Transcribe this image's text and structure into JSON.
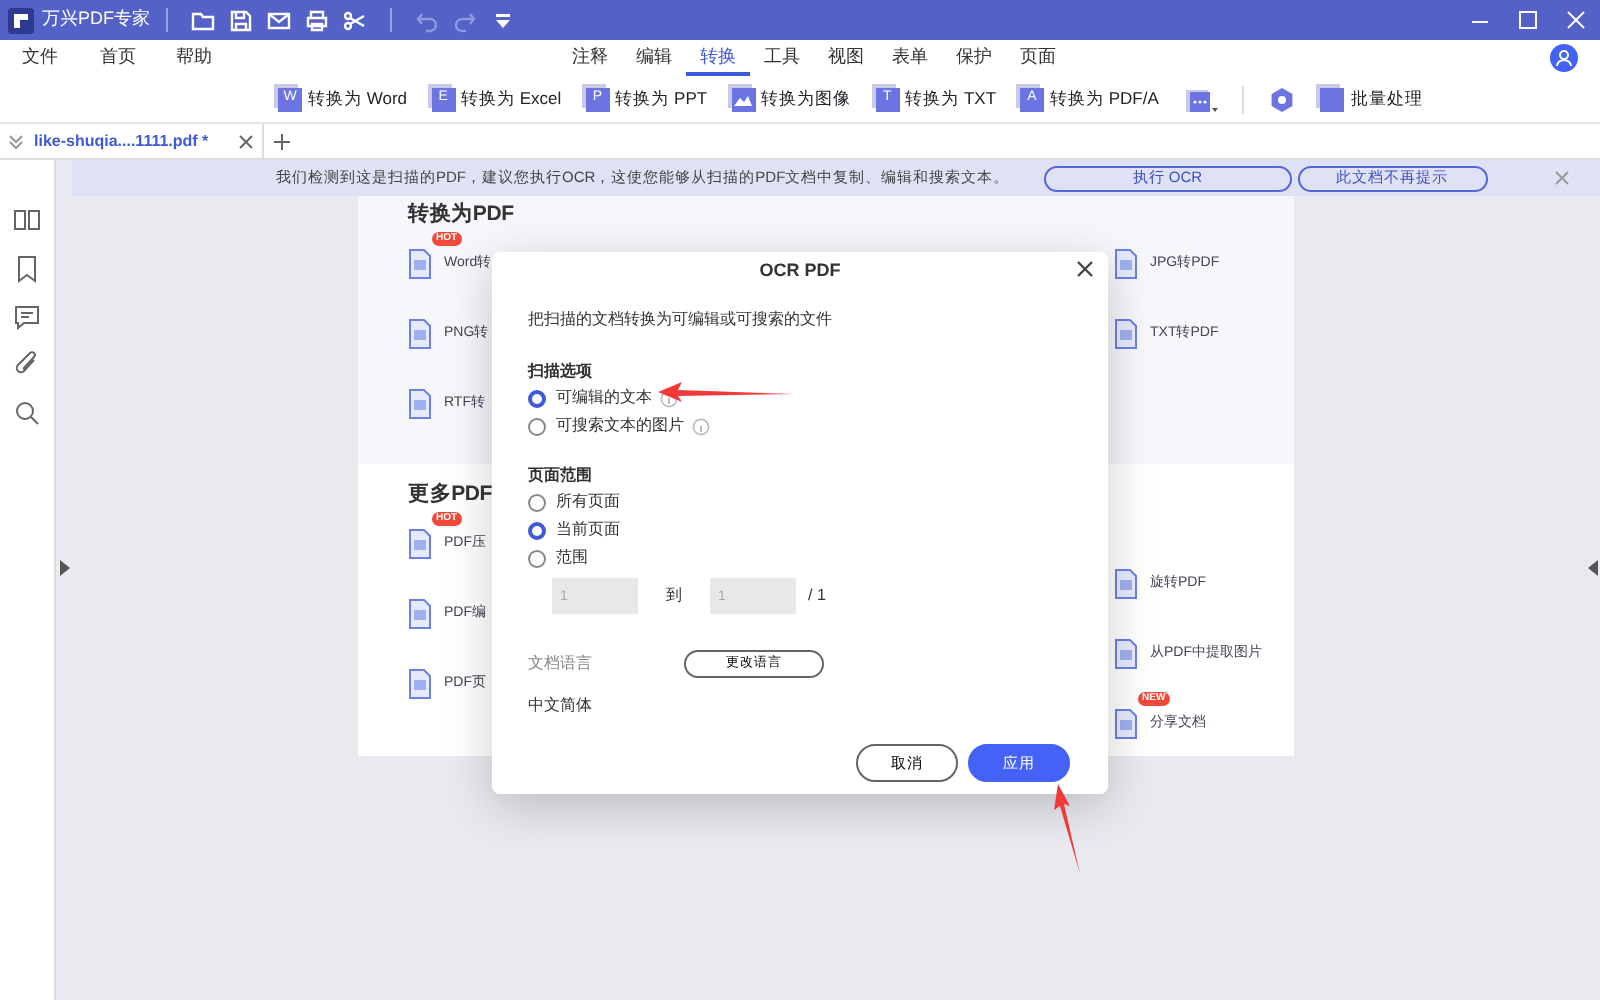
{
  "app": {
    "title": "万兴PDF专家"
  },
  "menu": [
    {
      "label": "文件"
    },
    {
      "label": "首页"
    },
    {
      "label": "帮助"
    }
  ],
  "ribbon_tabs": [
    {
      "label": "注释",
      "selected": false
    },
    {
      "label": "编辑",
      "selected": false
    },
    {
      "label": "转换",
      "selected": true
    },
    {
      "label": "工具",
      "selected": false
    },
    {
      "label": "视图",
      "selected": false
    },
    {
      "label": "表单",
      "selected": false
    },
    {
      "label": "保护",
      "selected": false
    },
    {
      "label": "页面",
      "selected": false
    }
  ],
  "toolbar": [
    {
      "kind": "letter",
      "glyph": "W",
      "label": "转换为 Word"
    },
    {
      "kind": "letter",
      "glyph": "E",
      "label": "转换为 Excel"
    },
    {
      "kind": "letter",
      "glyph": "P",
      "label": "转换为 PPT"
    },
    {
      "kind": "image",
      "label": "转换为图像"
    },
    {
      "kind": "letter",
      "glyph": "T",
      "label": "转换为 TXT"
    },
    {
      "kind": "letter",
      "glyph": "A",
      "label": "转换为 PDF/A"
    },
    {
      "kind": "more"
    },
    {
      "kind": "separator"
    },
    {
      "kind": "gear"
    },
    {
      "kind": "stack",
      "label": "批量处理"
    }
  ],
  "document_tab": {
    "title": "like-shuqia....1111.pdf *"
  },
  "notice": {
    "text": "我们检测到这是扫描的PDF，建议您执行OCR，这使您能够从扫描的PDF文档中复制、编辑和搜索文本。",
    "buttons": [
      "执行 OCR",
      "此文档不再提示"
    ]
  },
  "page": {
    "sections": [
      {
        "heading": "转换为PDF",
        "left": [
          {
            "label": "Word转",
            "badge": "HOT"
          },
          {
            "label": "PNG转"
          },
          {
            "label": "RTF转"
          }
        ],
        "right": [
          {
            "label": "JPG转PDF"
          },
          {
            "label": "TXT转PDF"
          }
        ]
      },
      {
        "heading": "更多PDF",
        "left": [
          {
            "label": "PDF压",
            "badge": "HOT"
          },
          {
            "label": "PDF编"
          },
          {
            "label": "PDF页"
          }
        ],
        "right": [
          {
            "label": "旋转PDF"
          },
          {
            "label": "从PDF中提取图片"
          },
          {
            "label": "分享文档",
            "badge": "NEW"
          }
        ]
      }
    ]
  },
  "dialog": {
    "title": "OCR PDF",
    "description": "把扫描的文档转换为可编辑或可搜索的文件",
    "scan_options": {
      "label": "扫描选项",
      "options": [
        {
          "label": "可编辑的文本",
          "selected": true
        },
        {
          "label": "可搜索文本的图片",
          "selected": false
        }
      ]
    },
    "page_range": {
      "label": "页面范围",
      "options": [
        {
          "label": "所有页面",
          "selected": false
        },
        {
          "label": "当前页面",
          "selected": true
        },
        {
          "label": "范围",
          "selected": false
        }
      ],
      "from": "1",
      "to_label": "到",
      "to": "1",
      "total": "/ 1"
    },
    "language": {
      "label": "文档语言",
      "button": "更改语言",
      "value": "中文简体"
    },
    "buttons": [
      {
        "label": "取消",
        "kind": "secondary"
      },
      {
        "label": "应用",
        "kind": "primary"
      }
    ]
  }
}
